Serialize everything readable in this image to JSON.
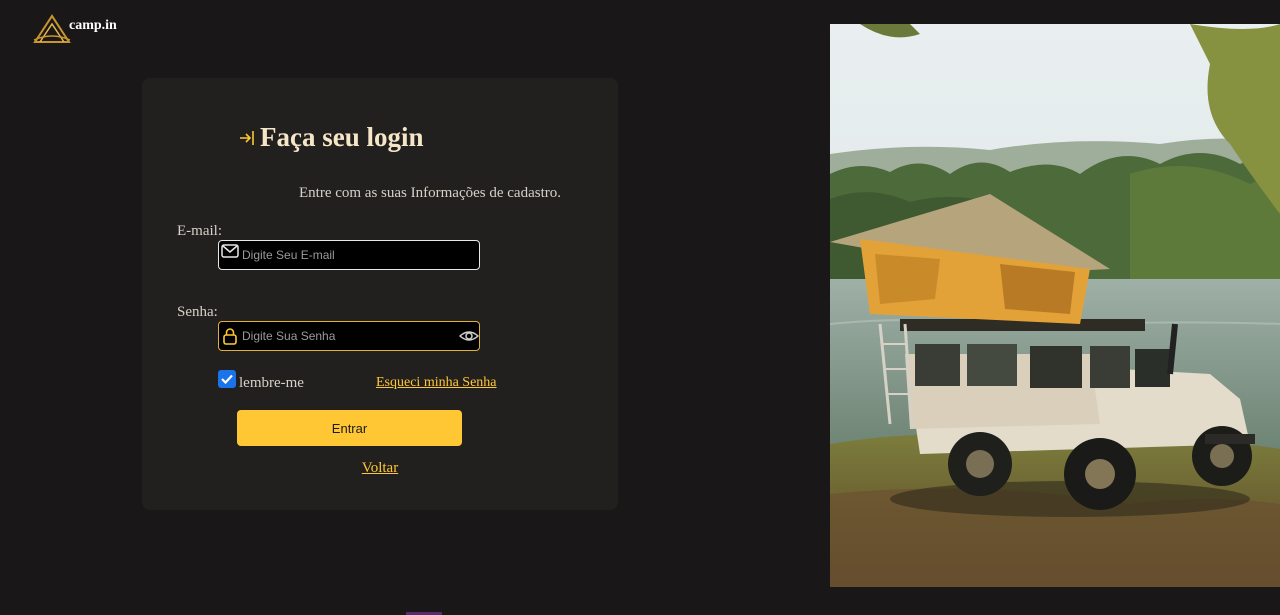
{
  "brand": {
    "name": "camp.in"
  },
  "login": {
    "title": "Faça seu login",
    "subtitle": "Entre com as suas Informações de cadastro.",
    "email_label": "E-mail:",
    "email_placeholder": "Digite Seu E-mail",
    "password_label": "Senha:",
    "password_placeholder": "Digite Sua Senha",
    "remember_label": "lembre-me",
    "remember_checked": true,
    "forgot_label": "Esqueci minha Senha",
    "submit_label": "Entrar",
    "back_label": "Voltar"
  },
  "icons": {
    "logo": "tent-logo-icon",
    "title": "login-arrow-icon",
    "email": "mail-icon",
    "password": "lock-icon",
    "toggle": "eye-icon"
  },
  "colors": {
    "accent": "#ffc734",
    "background": "#191717",
    "card": "#22201e",
    "title": "#f5e6c8"
  }
}
